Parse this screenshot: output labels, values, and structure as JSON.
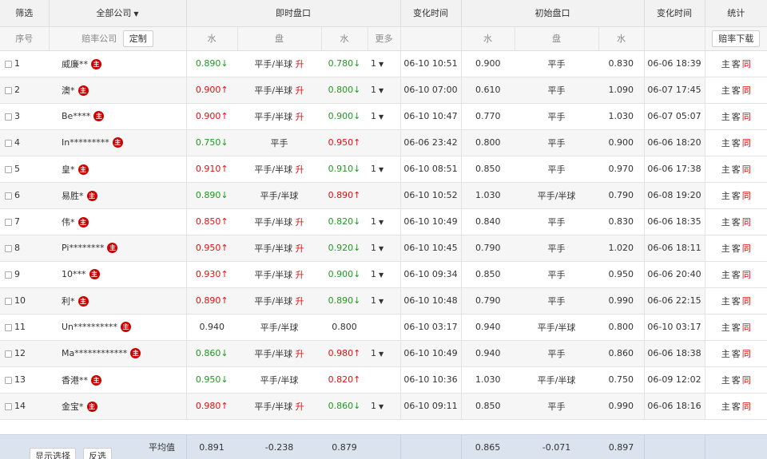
{
  "header": {
    "filter": "筛选",
    "all_companies": "全部公司",
    "live": "即时盘口",
    "change_time": "变化时间",
    "initial": "初始盘口",
    "change_time2": "变化时间",
    "stats": "统计"
  },
  "subheader": {
    "seq": "序号",
    "odds_company": "赔率公司",
    "customize": "定制",
    "water1": "水",
    "handicap": "盘",
    "water2": "水",
    "more": "更多",
    "init_water1": "水",
    "init_handicap": "盘",
    "init_water2": "水",
    "download": "赔率下载"
  },
  "stat_labels": {
    "home": "主",
    "away": "客",
    "same": "同"
  },
  "rows": [
    {
      "seq": "1",
      "company": "威廉**",
      "w1": "0.890↓",
      "w1c": "green",
      "pan": "平手/半球",
      "up": true,
      "w2": "0.780↓",
      "w2c": "green",
      "more": "1",
      "time": "06-10 10:51",
      "iw1": "0.900",
      "ipan": "平手",
      "iw2": "0.830",
      "itime": "06-06 18:39"
    },
    {
      "seq": "2",
      "company": "澳*",
      "w1": "0.900↑",
      "w1c": "red",
      "pan": "平手/半球",
      "up": true,
      "w2": "0.800↓",
      "w2c": "green",
      "more": "1",
      "time": "06-10 07:00",
      "iw1": "0.610",
      "ipan": "平手",
      "iw2": "1.090",
      "itime": "06-07 17:45"
    },
    {
      "seq": "3",
      "company": "Be****",
      "w1": "0.900↑",
      "w1c": "red",
      "pan": "平手/半球",
      "up": true,
      "w2": "0.900↓",
      "w2c": "green",
      "more": "1",
      "time": "06-10 10:47",
      "iw1": "0.770",
      "ipan": "平手",
      "iw2": "1.030",
      "itime": "06-07 05:07"
    },
    {
      "seq": "4",
      "company": "In*********",
      "w1": "0.750↓",
      "w1c": "green",
      "pan": "平手",
      "up": false,
      "w2": "0.950↑",
      "w2c": "red",
      "more": "",
      "time": "06-06 23:42",
      "iw1": "0.800",
      "ipan": "平手",
      "iw2": "0.900",
      "itime": "06-06 18:20"
    },
    {
      "seq": "5",
      "company": "皇*",
      "w1": "0.910↑",
      "w1c": "red",
      "pan": "平手/半球",
      "up": true,
      "w2": "0.910↓",
      "w2c": "green",
      "more": "1",
      "time": "06-10 08:51",
      "iw1": "0.850",
      "ipan": "平手",
      "iw2": "0.970",
      "itime": "06-06 17:38"
    },
    {
      "seq": "6",
      "company": "易胜*",
      "w1": "0.890↓",
      "w1c": "green",
      "pan": "平手/半球",
      "up": false,
      "w2": "0.890↑",
      "w2c": "red",
      "more": "",
      "time": "06-10 10:52",
      "iw1": "1.030",
      "ipan": "平手/半球",
      "iw2": "0.790",
      "itime": "06-08 19:20"
    },
    {
      "seq": "7",
      "company": "伟*",
      "w1": "0.850↑",
      "w1c": "red",
      "pan": "平手/半球",
      "up": true,
      "w2": "0.820↓",
      "w2c": "green",
      "more": "1",
      "time": "06-10 10:49",
      "iw1": "0.840",
      "ipan": "平手",
      "iw2": "0.830",
      "itime": "06-06 18:35"
    },
    {
      "seq": "8",
      "company": "Pi********",
      "w1": "0.950↑",
      "w1c": "red",
      "pan": "平手/半球",
      "up": true,
      "w2": "0.920↓",
      "w2c": "green",
      "more": "1",
      "time": "06-10 10:45",
      "iw1": "0.790",
      "ipan": "平手",
      "iw2": "1.020",
      "itime": "06-06 18:11"
    },
    {
      "seq": "9",
      "company": "10***",
      "w1": "0.930↑",
      "w1c": "red",
      "pan": "平手/半球",
      "up": true,
      "w2": "0.900↓",
      "w2c": "green",
      "more": "1",
      "time": "06-10 09:34",
      "iw1": "0.850",
      "ipan": "平手",
      "iw2": "0.950",
      "itime": "06-06 20:40"
    },
    {
      "seq": "10",
      "company": "利*",
      "w1": "0.890↑",
      "w1c": "red",
      "pan": "平手/半球",
      "up": true,
      "w2": "0.890↓",
      "w2c": "green",
      "more": "1",
      "time": "06-10 10:48",
      "iw1": "0.790",
      "ipan": "平手",
      "iw2": "0.990",
      "itime": "06-06 22:15"
    },
    {
      "seq": "11",
      "company": "Un**********",
      "w1": "0.940",
      "w1c": "plain",
      "pan": "平手/半球",
      "up": false,
      "w2": "0.800",
      "w2c": "plain",
      "more": "",
      "time": "06-10 03:17",
      "iw1": "0.940",
      "ipan": "平手/半球",
      "iw2": "0.800",
      "itime": "06-10 03:17"
    },
    {
      "seq": "12",
      "company": "Ma************",
      "w1": "0.860↓",
      "w1c": "green",
      "pan": "平手/半球",
      "up": true,
      "w2": "0.980↑",
      "w2c": "red",
      "more": "1",
      "time": "06-10 10:49",
      "iw1": "0.940",
      "ipan": "平手",
      "iw2": "0.860",
      "itime": "06-06 18:38"
    },
    {
      "seq": "13",
      "company": "香港**",
      "w1": "0.950↓",
      "w1c": "green",
      "pan": "平手/半球",
      "up": false,
      "w2": "0.820↑",
      "w2c": "red",
      "more": "",
      "time": "06-10 10:36",
      "iw1": "1.030",
      "ipan": "平手/半球",
      "iw2": "0.750",
      "itime": "06-09 12:02"
    },
    {
      "seq": "14",
      "company": "金宝*",
      "w1": "0.980↑",
      "w1c": "red",
      "pan": "平手/半球",
      "up": true,
      "w2": "0.860↓",
      "w2c": "green",
      "more": "1",
      "time": "06-10 09:11",
      "iw1": "0.850",
      "ipan": "平手",
      "iw2": "0.990",
      "itime": "06-06 18:16"
    }
  ],
  "footer": {
    "show_selected": "显示选择",
    "invert": "反选",
    "avg_label": "平均值",
    "avg_w1": "0.891",
    "avg_pan": "-0.238",
    "avg_w2": "0.879",
    "avg_iw1": "0.865",
    "avg_ipan": "-0.071",
    "avg_iw2": "0.897"
  }
}
